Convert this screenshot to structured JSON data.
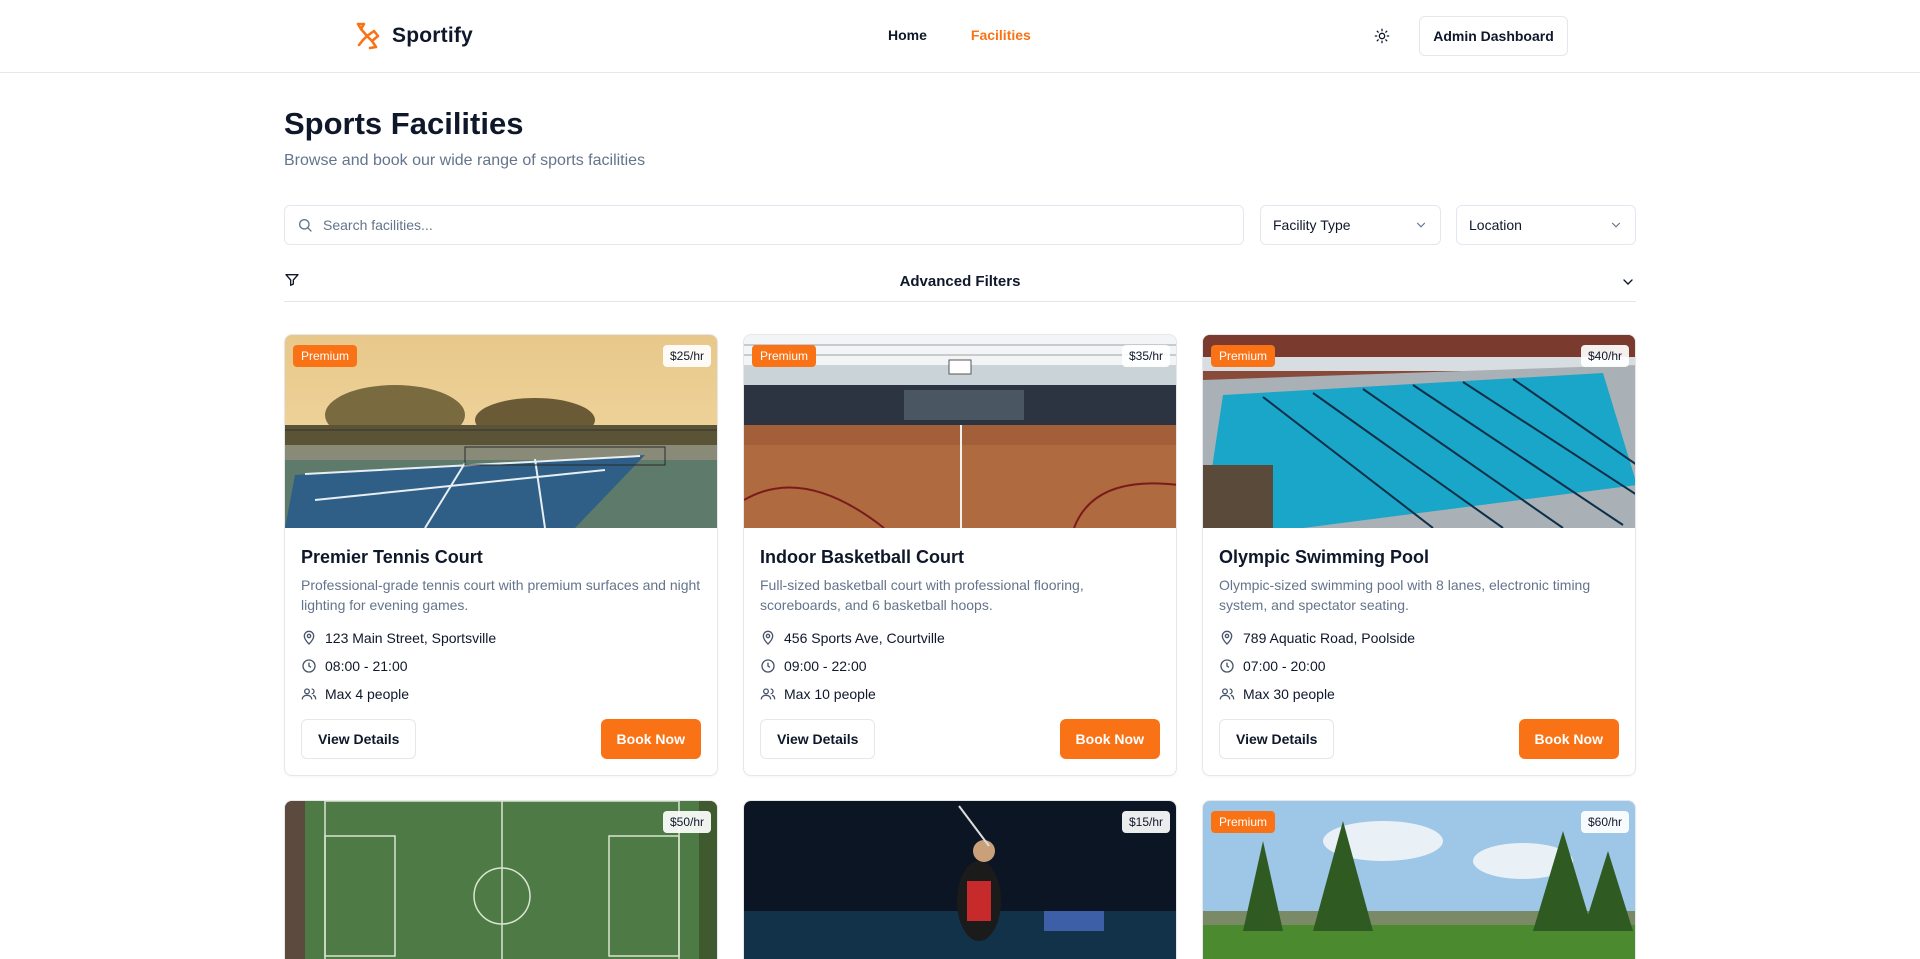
{
  "header": {
    "brand": "Sportify",
    "nav": [
      {
        "label": "Home",
        "active": false
      },
      {
        "label": "Facilities",
        "active": true
      }
    ],
    "admin_label": "Admin Dashboard"
  },
  "page": {
    "title": "Sports Facilities",
    "subtitle": "Browse and book our wide range of sports facilities"
  },
  "filters": {
    "search_placeholder": "Search facilities...",
    "type_label": "Facility Type",
    "location_label": "Location",
    "advanced_label": "Advanced Filters"
  },
  "facilities": [
    {
      "name": "Premier Tennis Court",
      "description": "Professional-grade tennis court with premium surfaces and night lighting for evening games.",
      "address": "123 Main Street, Sportsville",
      "hours": "08:00 - 21:00",
      "capacity": "Max 4 people",
      "price": "$25/hr",
      "badge": "Premium",
      "view_label": "View Details",
      "book_label": "Book Now"
    },
    {
      "name": "Indoor Basketball Court",
      "description": "Full-sized basketball court with professional flooring, scoreboards, and 6 basketball hoops.",
      "address": "456 Sports Ave, Courtville",
      "hours": "09:00 - 22:00",
      "capacity": "Max 10 people",
      "price": "$35/hr",
      "badge": "Premium",
      "view_label": "View Details",
      "book_label": "Book Now"
    },
    {
      "name": "Olympic Swimming Pool",
      "description": "Olympic-sized swimming pool with 8 lanes, electronic timing system, and spectator seating.",
      "address": "789 Aquatic Road, Poolside",
      "hours": "07:00 - 20:00",
      "capacity": "Max 30 people",
      "price": "$40/hr",
      "badge": "Premium",
      "view_label": "View Details",
      "book_label": "Book Now"
    },
    {
      "price": "$50/hr"
    },
    {
      "price": "$15/hr"
    },
    {
      "price": "$60/hr",
      "badge": "Premium"
    }
  ],
  "colors": {
    "accent": "#f97316",
    "text": "#0f172a",
    "muted": "#64748b",
    "border": "#e5e7eb"
  }
}
